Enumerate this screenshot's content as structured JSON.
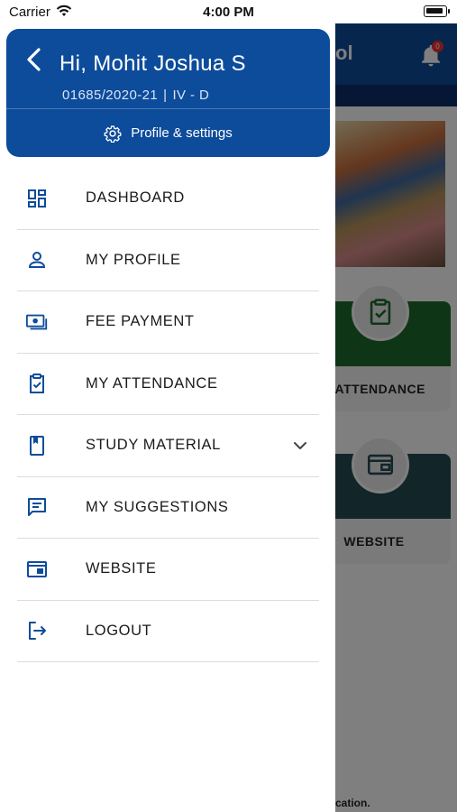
{
  "status_bar": {
    "carrier": "Carrier",
    "time": "4:00 PM"
  },
  "background": {
    "header_title": "ol",
    "notification_count": "0",
    "cards": [
      {
        "label": "Y ATTENDANCE",
        "color": "#1f6b2e"
      },
      {
        "label": "WEBSITE",
        "color": "#244a52"
      }
    ],
    "footer_text": "cation."
  },
  "drawer": {
    "greeting": "Hi, Mohit Joshua S",
    "admission_no": "01685/2020-21",
    "separator": "|",
    "class_section": "IV - D",
    "profile_settings_label": "Profile & settings",
    "accent_color": "#0d4c9b",
    "items": [
      {
        "label": "DASHBOARD",
        "icon": "dashboard-icon"
      },
      {
        "label": "MY PROFILE",
        "icon": "person-icon"
      },
      {
        "label": "FEE PAYMENT",
        "icon": "payment-icon"
      },
      {
        "label": "MY ATTENDANCE",
        "icon": "clipboard-check-icon"
      },
      {
        "label": "STUDY MATERIAL",
        "icon": "book-icon",
        "expandable": true
      },
      {
        "label": "MY SUGGESTIONS",
        "icon": "chat-icon"
      },
      {
        "label": "WEBSITE",
        "icon": "web-icon"
      },
      {
        "label": "LOGOUT",
        "icon": "logout-icon"
      }
    ]
  }
}
